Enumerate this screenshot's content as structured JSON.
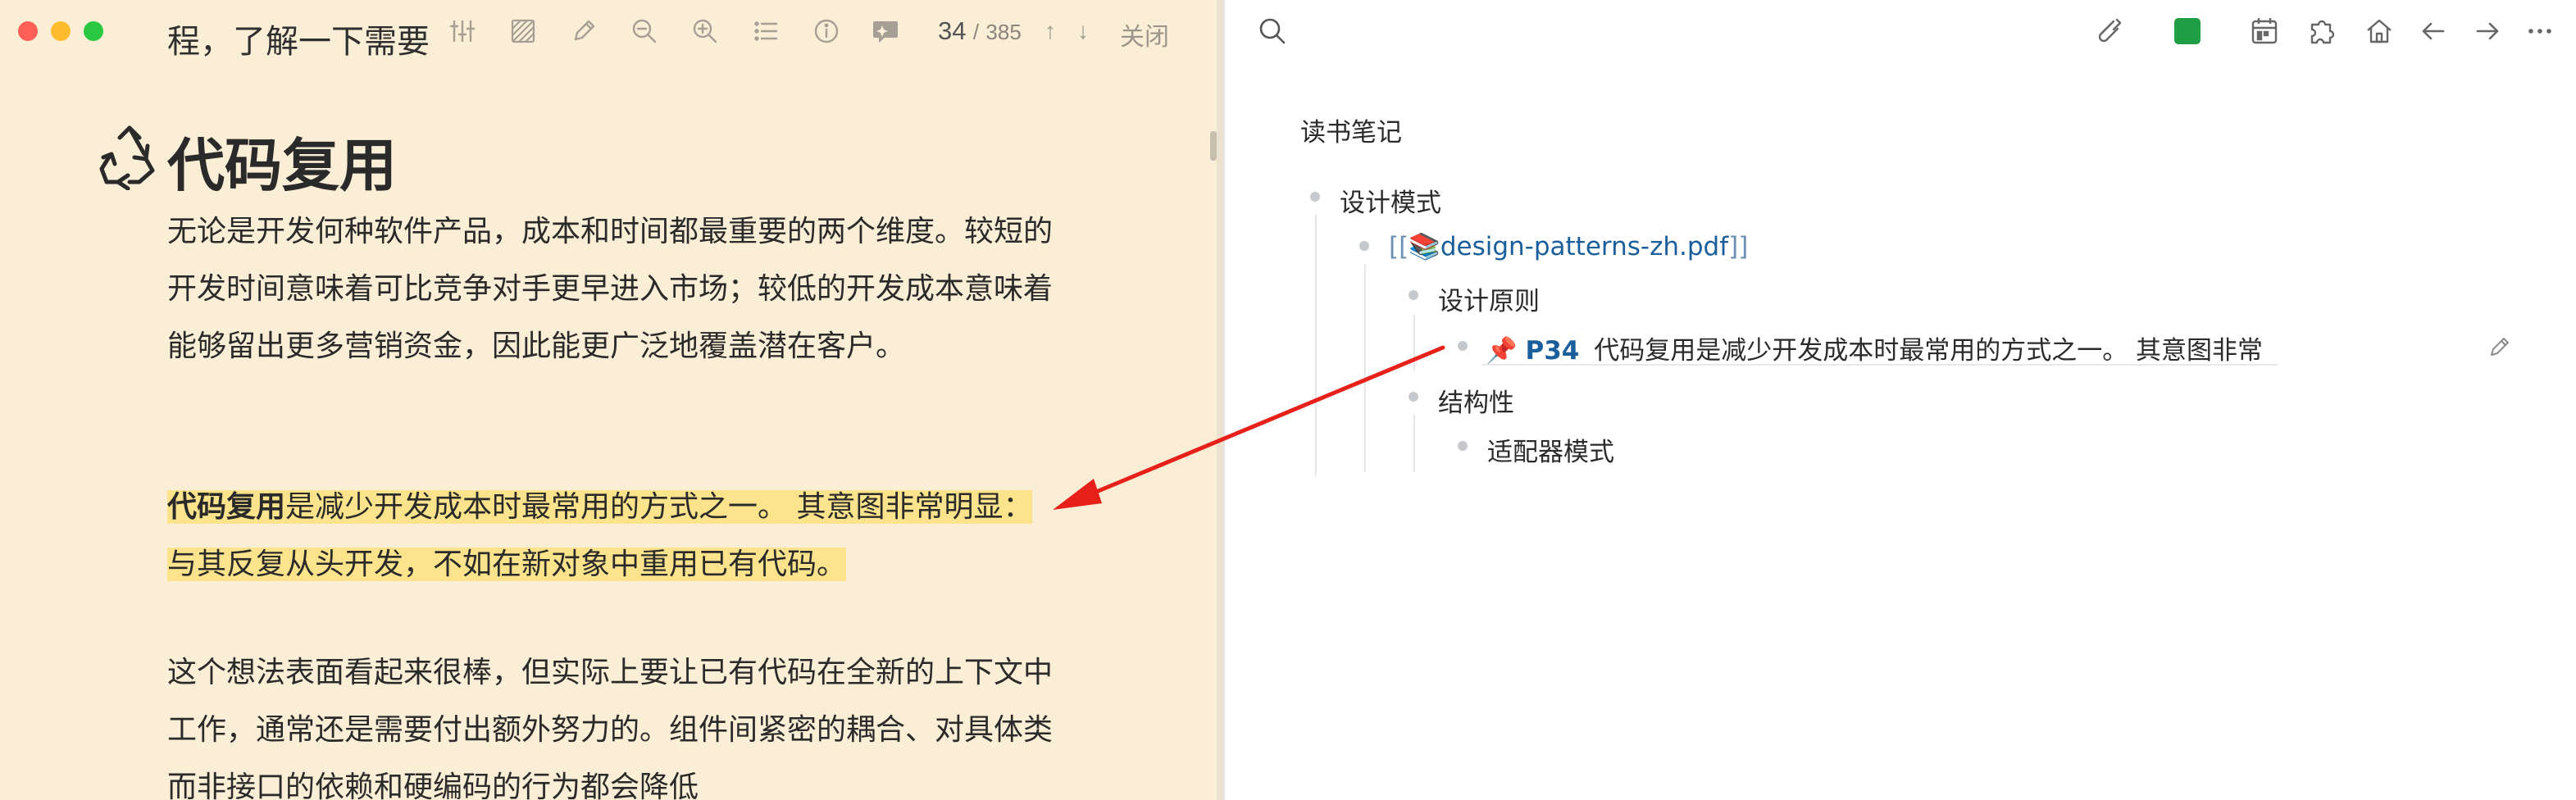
{
  "left_pane": {
    "toolbar": {
      "snippet": "程，了解一下需要",
      "page_current": "34",
      "page_separator": "/",
      "page_total": "385",
      "close_label": "关闭",
      "icons": [
        "sliders-icon",
        "highlight-area-icon",
        "pencil-icon",
        "zoom-out-icon",
        "zoom-in-icon",
        "outline-list-icon",
        "info-icon",
        "ai-chat-icon",
        "arrow-up-icon",
        "arrow-down-icon"
      ]
    },
    "document": {
      "heading": "代码复用",
      "heading_icon": "recycle-icon",
      "paragraph1": "无论是开发何种软件产品，成本和时间都最重要的两个维度。较短的开发时间意味着可比竞争对手更早进入市场；较低的开发成本意味着能够留出更多营销资金，因此能更广泛地覆盖潜在客户。",
      "highlight_bold": "代码复用",
      "highlight_rest": "是减少开发成本时最常用的方式之一。 其意图非常明显：与其反复从头开发，不如在新对象中重用已有代码。",
      "paragraph3": "这个想法表面看起来很棒，但实际上要让已有代码在全新的上下文中工作，通常还是需要付出额外努力的。组件间紧密的耦合、对具体类而非接口的依赖和硬编码的行为都会降低",
      "highlight_color": "#fde48c"
    }
  },
  "right_pane": {
    "toolbar_icons": [
      "search-icon",
      "paperclip-pen-icon",
      "green-square-icon",
      "calendar-icon",
      "puzzle-icon",
      "home-icon",
      "arrow-left-icon",
      "arrow-right-icon",
      "more-icon"
    ],
    "accent_green": "#1f9e46",
    "page_title": "读书笔记",
    "outline": {
      "level0": "设计模式",
      "link_open": "[[",
      "link_emoji": "📚",
      "link_text": "design-patterns-zh.pdf",
      "link_close": "]]",
      "level2a": "设计原则",
      "pin_emoji": "📌",
      "page_badge": "P34",
      "quote": "代码复用是减少开发成本时最常用的方式之一。 其意图非常",
      "level2b": "结构性",
      "level3": "适配器模式"
    },
    "link_color": "#1a5f9c"
  },
  "annotation": {
    "arrow_color": "#e8201a"
  }
}
